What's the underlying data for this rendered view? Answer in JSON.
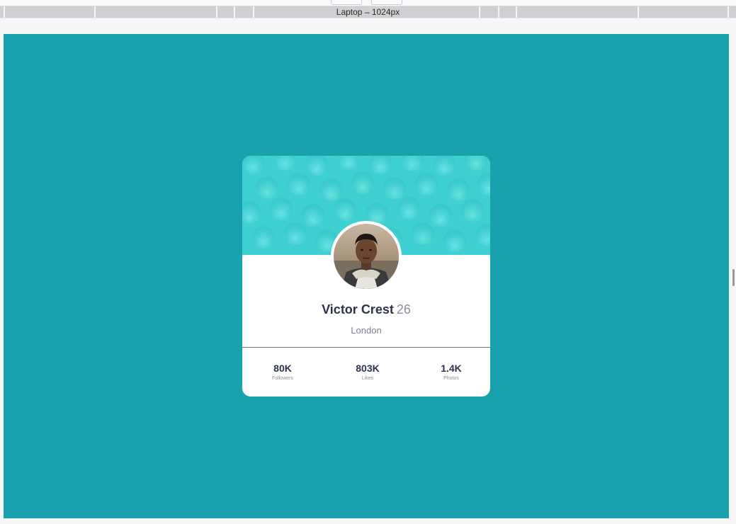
{
  "devtools": {
    "ruler_label": "Laptop – 1024px"
  },
  "colors": {
    "page_background": "#1aa1ae",
    "card_header": "#3fd0d2",
    "text_dark": "#2e3349",
    "text_muted": "#8c8f99"
  },
  "profile": {
    "name": "Victor Crest",
    "age": "26",
    "location": "London",
    "avatar": "avatar-photo-icon"
  },
  "stats": [
    {
      "value": "80K",
      "label": "Followers"
    },
    {
      "value": "803K",
      "label": "Likes"
    },
    {
      "value": "1.4K",
      "label": "Photos"
    }
  ]
}
